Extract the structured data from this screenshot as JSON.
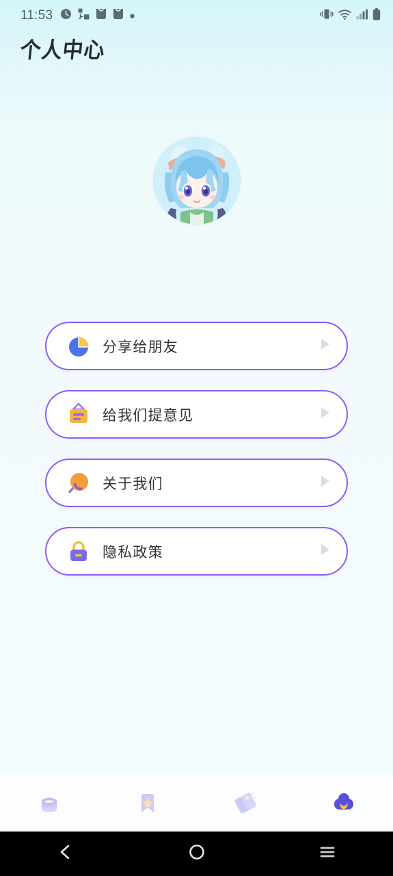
{
  "status_bar": {
    "time": "11:53",
    "left_icons": [
      "clock-icon",
      "share-network-icon",
      "notification-bag-icon",
      "notification-bag-icon",
      "dot-icon"
    ],
    "right_icons": [
      "vibrate-icon",
      "wifi-icon",
      "signal-icon",
      "battery-icon"
    ]
  },
  "header": {
    "title": "个人中心"
  },
  "avatar": {
    "name": "user-avatar",
    "description": "anime-girl-blue-hair"
  },
  "menu": {
    "items": [
      {
        "label": "分享给朋友",
        "icon": "pie-chart-share-icon",
        "arrow": "chevron-right-icon"
      },
      {
        "label": "给我们提意见",
        "icon": "feedback-board-icon",
        "arrow": "chevron-right-icon"
      },
      {
        "label": "关于我们",
        "icon": "magnifier-about-icon",
        "arrow": "chevron-right-icon"
      },
      {
        "label": "隐私政策",
        "icon": "lock-privacy-icon",
        "arrow": "chevron-right-icon"
      }
    ]
  },
  "tab_bar": {
    "active_index": 3,
    "tabs": [
      {
        "icon": "inbox-icon",
        "label": ""
      },
      {
        "icon": "bookmark-star-icon",
        "label": ""
      },
      {
        "icon": "price-tags-icon",
        "label": ""
      },
      {
        "icon": "profile-cloud-icon",
        "label": ""
      }
    ]
  },
  "nav_bar": {
    "buttons": [
      {
        "icon": "back-chevron-icon"
      },
      {
        "icon": "home-circle-icon"
      },
      {
        "icon": "recents-menu-icon"
      }
    ]
  },
  "colors": {
    "accent_purple": "#8b5cf6",
    "card_white": "#ffffff",
    "bg_top": "#d4f6fb",
    "bg_bottom": "#f2fafd",
    "text_primary": "#2f3439",
    "status_text": "#4c5d63",
    "tab_active": "#5a4be0",
    "tab_inactive": "#ccc8f5"
  }
}
